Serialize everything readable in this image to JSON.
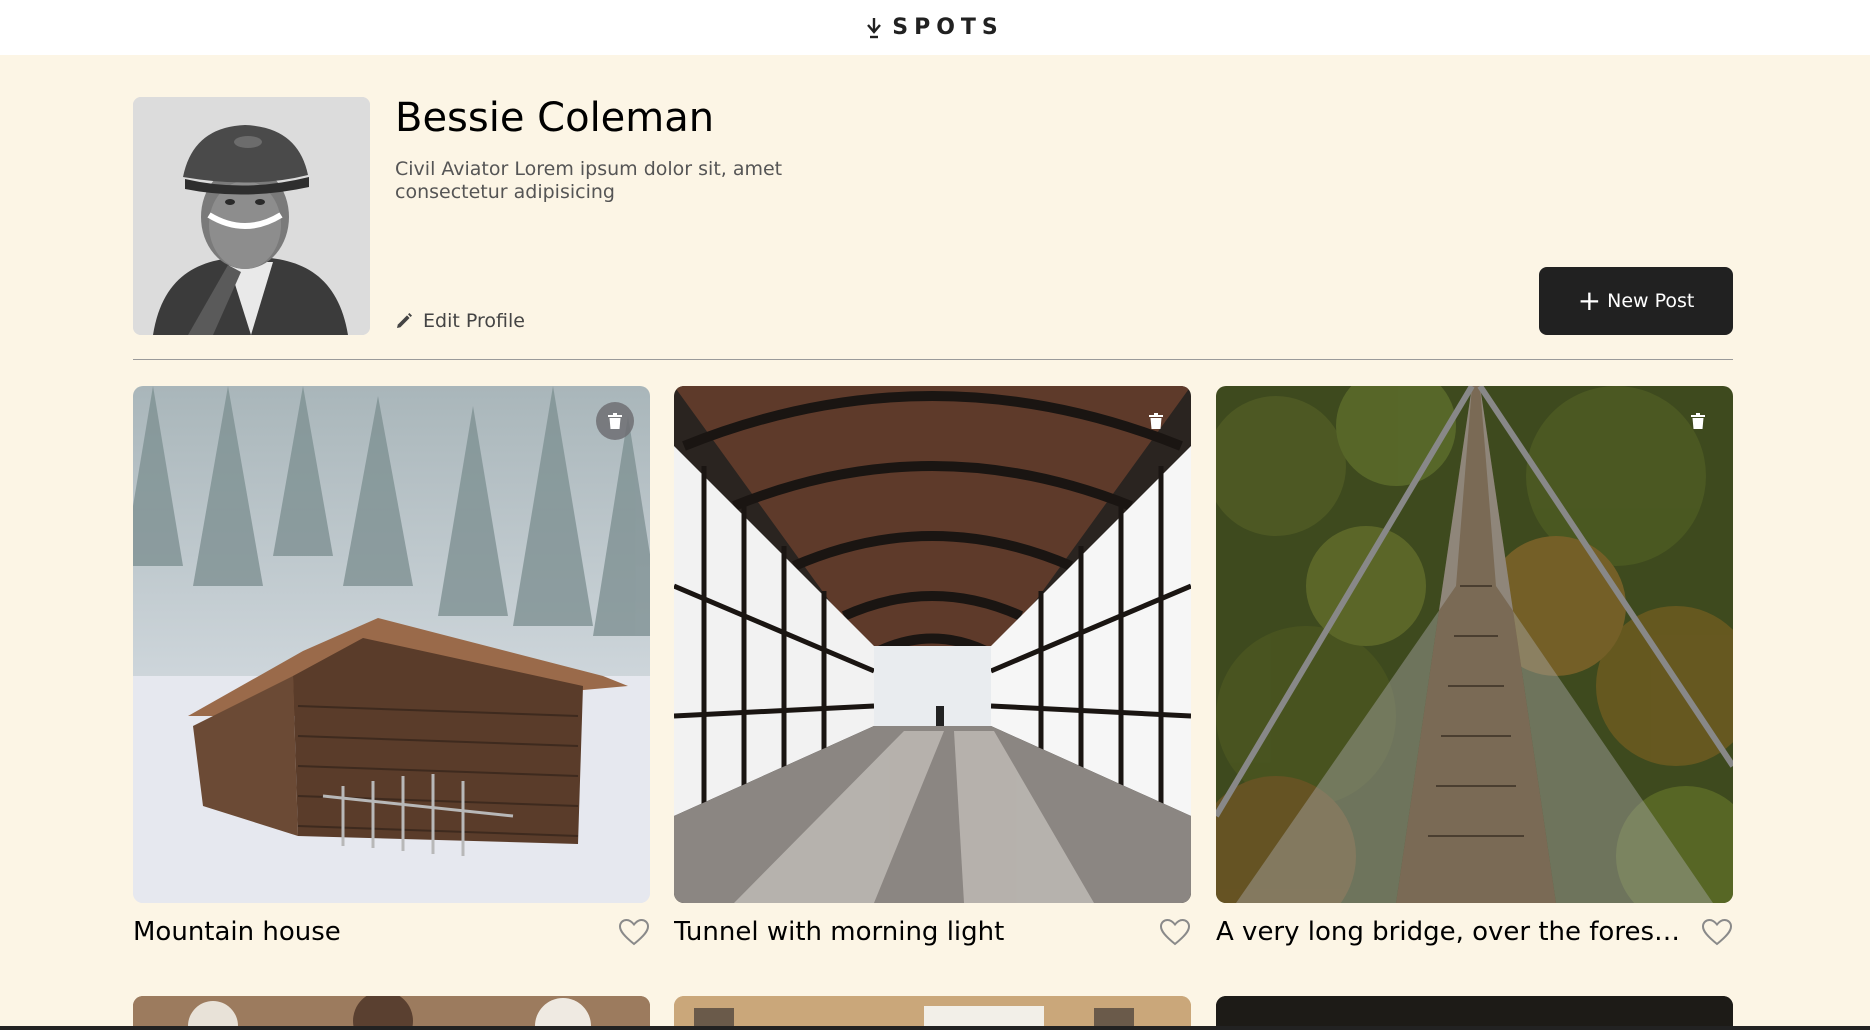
{
  "header": {
    "logo_text": "SPOTS"
  },
  "profile": {
    "name": "Bessie Coleman",
    "description": "Civil Aviator Lorem ipsum dolor sit, amet consectetur adipisicing",
    "edit_label": "Edit Profile",
    "new_post_label": "New Post",
    "new_post_icon": "+"
  },
  "cards": [
    {
      "title": "Mountain house",
      "delete_icon": "trash-icon",
      "like_icon": "heart-icon",
      "liked": false
    },
    {
      "title": "Tunnel with morning light",
      "delete_icon": "trash-icon",
      "like_icon": "heart-icon",
      "liked": false
    },
    {
      "title": "A very long bridge, over the forest and through the trees",
      "delete_icon": "trash-icon",
      "like_icon": "heart-icon",
      "liked": false
    }
  ],
  "colors": {
    "background": "#fcf5e5",
    "header": "#ffffff",
    "button": "#212121",
    "text": "#212121"
  }
}
